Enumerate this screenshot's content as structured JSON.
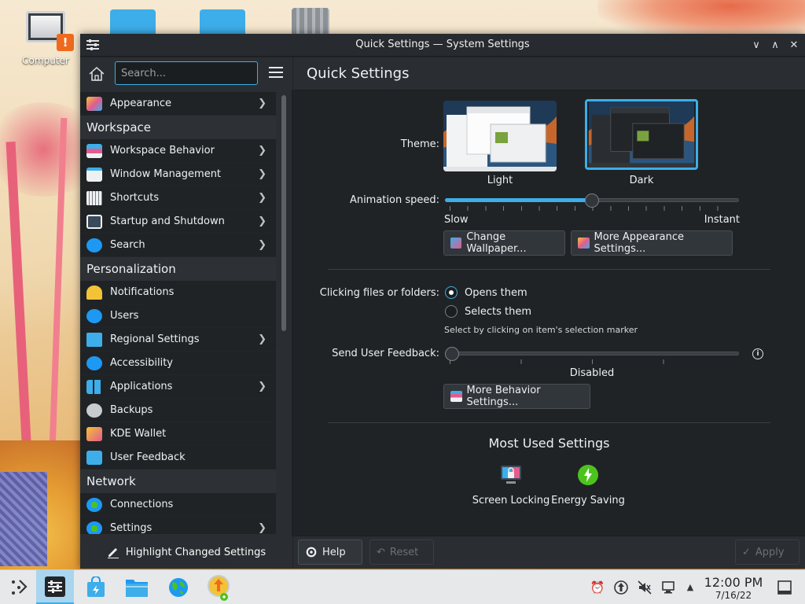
{
  "desktop": {
    "computer_label": "Computer",
    "warning_glyph": "!"
  },
  "window": {
    "title": "Quick Settings — System Settings",
    "controls": {
      "minimize": "∨",
      "maximize": "∧",
      "close": "✕"
    }
  },
  "sidebar": {
    "search_placeholder": "Search...",
    "items": [
      {
        "type": "item",
        "label": "Appearance",
        "icon": "appearance-icon",
        "chevron": true
      },
      {
        "type": "category",
        "label": "Workspace"
      },
      {
        "type": "item",
        "label": "Workspace Behavior",
        "icon": "workspace-behavior-icon",
        "chevron": true
      },
      {
        "type": "item",
        "label": "Window Management",
        "icon": "window-management-icon",
        "chevron": true
      },
      {
        "type": "item",
        "label": "Shortcuts",
        "icon": "keyboard-icon",
        "chevron": true
      },
      {
        "type": "item",
        "label": "Startup and Shutdown",
        "icon": "startup-icon",
        "chevron": true
      },
      {
        "type": "item",
        "label": "Search",
        "icon": "search-icon",
        "chevron": true
      },
      {
        "type": "category",
        "label": "Personalization"
      },
      {
        "type": "item",
        "label": "Notifications",
        "icon": "bell-icon",
        "chevron": false
      },
      {
        "type": "item",
        "label": "Users",
        "icon": "users-icon",
        "chevron": false
      },
      {
        "type": "item",
        "label": "Regional Settings",
        "icon": "regional-icon",
        "chevron": true
      },
      {
        "type": "item",
        "label": "Accessibility",
        "icon": "accessibility-icon",
        "chevron": false
      },
      {
        "type": "item",
        "label": "Applications",
        "icon": "applications-icon",
        "chevron": true
      },
      {
        "type": "item",
        "label": "Backups",
        "icon": "backups-icon",
        "chevron": false
      },
      {
        "type": "item",
        "label": "KDE Wallet",
        "icon": "wallet-icon",
        "chevron": false
      },
      {
        "type": "item",
        "label": "User Feedback",
        "icon": "feedback-icon",
        "chevron": false
      },
      {
        "type": "category",
        "label": "Network"
      },
      {
        "type": "item",
        "label": "Connections",
        "icon": "globe-icon",
        "chevron": false
      },
      {
        "type": "item",
        "label": "Settings",
        "icon": "network-settings-icon",
        "chevron": true
      }
    ],
    "footer_button": "Highlight Changed Settings"
  },
  "main": {
    "title": "Quick Settings",
    "theme_label": "Theme:",
    "themes": [
      {
        "label": "Light",
        "selected": false
      },
      {
        "label": "Dark",
        "selected": true
      }
    ],
    "animation_label": "Animation speed:",
    "animation_value": 0.5,
    "animation_min_label": "Slow",
    "animation_max_label": "Instant",
    "change_wallpaper_button": "Change Wallpaper...",
    "more_appearance_button": "More Appearance Settings...",
    "clicking_label": "Clicking files or folders:",
    "click_options": [
      {
        "label": "Opens them",
        "selected": true
      },
      {
        "label": "Selects them",
        "selected": false
      }
    ],
    "click_hint": "Select by clicking on item's selection marker",
    "feedback_label": "Send User Feedback:",
    "feedback_value": 0,
    "feedback_value_label": "Disabled",
    "more_behavior_button": "More Behavior Settings...",
    "most_used_title": "Most Used Settings",
    "most_used": [
      {
        "label": "Screen Locking"
      },
      {
        "label": "Energy Saving"
      }
    ]
  },
  "footer": {
    "help": "Help",
    "reset": "Reset",
    "apply": "Apply"
  },
  "taskbar": {
    "time": "12:00 PM",
    "date": "7/16/22"
  },
  "colors": {
    "accent": "#3daee9",
    "window_bg": "#202326",
    "panel_bg": "#2a2e32",
    "taskbar_bg": "#e6e8ea"
  }
}
